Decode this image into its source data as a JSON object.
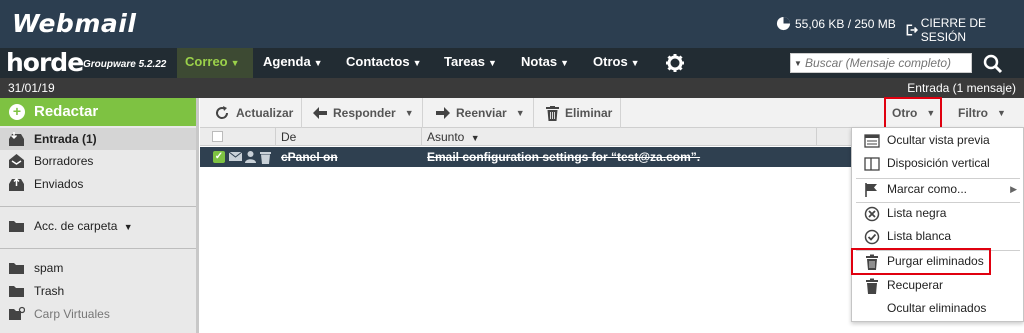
{
  "header": {
    "app_title": "Webmail",
    "quota_text": "55,06 KB / 250 MB",
    "logout_label": "CIERRE DE SESIÓN"
  },
  "nav": {
    "brand": "horde",
    "brand_sub": "Groupware 5.2.22",
    "items": [
      {
        "label": "Correo",
        "active": true
      },
      {
        "label": "Agenda"
      },
      {
        "label": "Contactos"
      },
      {
        "label": "Tareas"
      },
      {
        "label": "Notas"
      },
      {
        "label": "Otros"
      }
    ],
    "search_placeholder": "Buscar (Mensaje completo)"
  },
  "status": {
    "date": "31/01/19",
    "folder_count": "Entrada (1 mensaje)"
  },
  "sidebar": {
    "compose_label": "Redactar",
    "folders": [
      {
        "label": "Entrada (1)",
        "icon": "inbox-icon",
        "selected": true
      },
      {
        "label": "Borradores",
        "icon": "drafts-icon"
      },
      {
        "label": "Enviados",
        "icon": "sent-icon"
      }
    ],
    "folder_actions_label": "Acc. de carpeta",
    "extra_folders": [
      {
        "label": "spam",
        "icon": "folder-icon"
      },
      {
        "label": "Trash",
        "icon": "folder-icon"
      },
      {
        "label": "Carp Virtuales",
        "icon": "virtual-folder-icon"
      }
    ]
  },
  "toolbar": {
    "refresh_label": "Actualizar",
    "reply_label": "Responder",
    "forward_label": "Reenviar",
    "delete_label": "Eliminar",
    "other_label": "Otro",
    "filter_label": "Filtro"
  },
  "list": {
    "columns": {
      "from": "De",
      "subject": "Asunto"
    },
    "messages": [
      {
        "from": "cPanel on",
        "subject": "Email configuration settings for “test@za.com”.",
        "checked": true,
        "deleted": true
      }
    ]
  },
  "menu": {
    "items": [
      {
        "label": "Ocultar vista previa",
        "icon": "preview-icon"
      },
      {
        "label": "Disposición vertical",
        "icon": "layout-icon"
      },
      {
        "label": "Marcar como...",
        "icon": "flag-icon",
        "submenu": true
      },
      {
        "label": "Lista negra",
        "icon": "blacklist-icon"
      },
      {
        "label": "Lista blanca",
        "icon": "whitelist-icon"
      },
      {
        "label": "Purgar eliminados",
        "icon": "trash-icon",
        "highlighted": true
      },
      {
        "label": "Recuperar",
        "icon": "undelete-icon"
      },
      {
        "label": "Ocultar eliminados",
        "icon": ""
      }
    ]
  },
  "colors": {
    "header_bg": "#2c3e50",
    "nav_bg": "#222c33",
    "accent_green": "#7ec242",
    "selected_row": "#2f4050",
    "highlight_red": "#e0000f"
  }
}
